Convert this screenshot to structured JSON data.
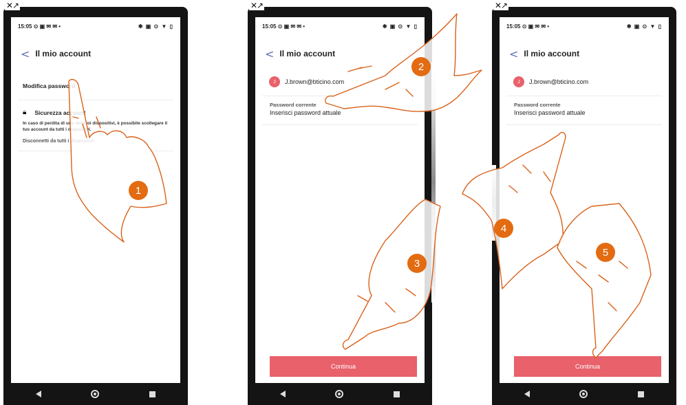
{
  "status": {
    "time": "15:05",
    "left_icons": "⊙ ▣ ✉ ✉ •",
    "right_icons": "✱ ▣ ⊙ ▼ ▯"
  },
  "corner_icons": "✕↗",
  "screens": [
    {
      "header": {
        "back": "<",
        "title": "Il mio account"
      },
      "change_password": "Modifica password",
      "security_title": "Sicurezza account",
      "security_text": "In caso di perdita di uno dei tuoi dispositivi, è possibile scollegare il tuo account da tutti i dispositivi.",
      "disconnect": "Disconnetti da tutti i dispositivi"
    },
    {
      "header": {
        "back": "<",
        "title": "Il mio account"
      },
      "avatar": "J",
      "email": "J.brown@bticino.com",
      "password_label": "Password corrente",
      "password_value": "Inserisci password attuale",
      "button": "Continua"
    },
    {
      "header": {
        "back": "<",
        "title": "Il mio account"
      },
      "avatar": "J",
      "email": "J.brown@bticino.com",
      "password_label": "Password corrente",
      "password_value": "Inserisci password attuale",
      "button": "Continua"
    }
  ],
  "steps": [
    "1",
    "2",
    "3",
    "4",
    "5"
  ],
  "colors": {
    "accent": "#e8616b",
    "step": "#e36b12",
    "back": "#5a6eb6",
    "hand_outline": "#d9611a"
  }
}
